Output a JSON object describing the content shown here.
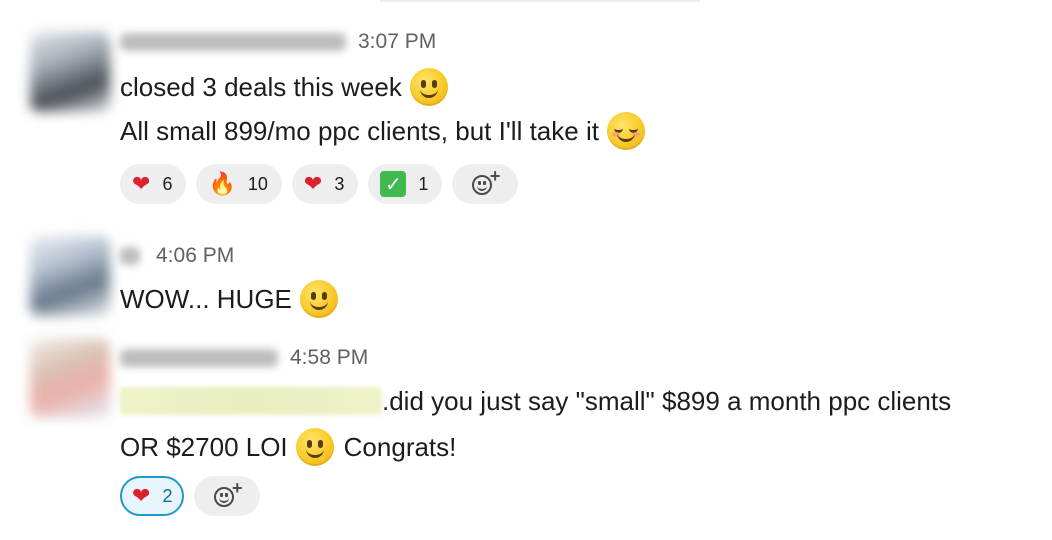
{
  "messages": [
    {
      "time": "3:07 PM",
      "lines": [
        {
          "text": "closed 3 deals this week",
          "emoji": "slightly-smiling-face"
        },
        {
          "text": "All small 899/mo ppc clients, but I'll take it",
          "emoji": "relieved-face"
        }
      ],
      "reactions": [
        {
          "icon": "heart",
          "glyph": "❤",
          "count": "6"
        },
        {
          "icon": "fire",
          "glyph": "🔥",
          "count": "10"
        },
        {
          "icon": "heart",
          "glyph": "❤",
          "count": "3"
        },
        {
          "icon": "white-check-mark",
          "glyph": "✓",
          "count": "1"
        }
      ]
    },
    {
      "time": "4:06 PM",
      "lines": [
        {
          "text": "WOW... HUGE",
          "emoji": "slightly-smiling-face"
        }
      ]
    },
    {
      "time": "4:58 PM",
      "lines": [
        {
          "text": ".did you just say \"small\"  $899 a month ppc clients"
        },
        {
          "text_before": "OR $2700 LOI",
          "emoji": "slightly-smiling-face",
          "text_after": "Congrats!"
        }
      ],
      "reactions": [
        {
          "icon": "heart",
          "glyph": "❤",
          "count": "2",
          "selected": true
        }
      ]
    }
  ],
  "colors": {
    "accent_selected_border": "#1d9bd1",
    "selected_count": "#1264a3",
    "pill_bg": "#eeeeee",
    "timestamp": "#616061",
    "text": "#1d1c1d"
  }
}
